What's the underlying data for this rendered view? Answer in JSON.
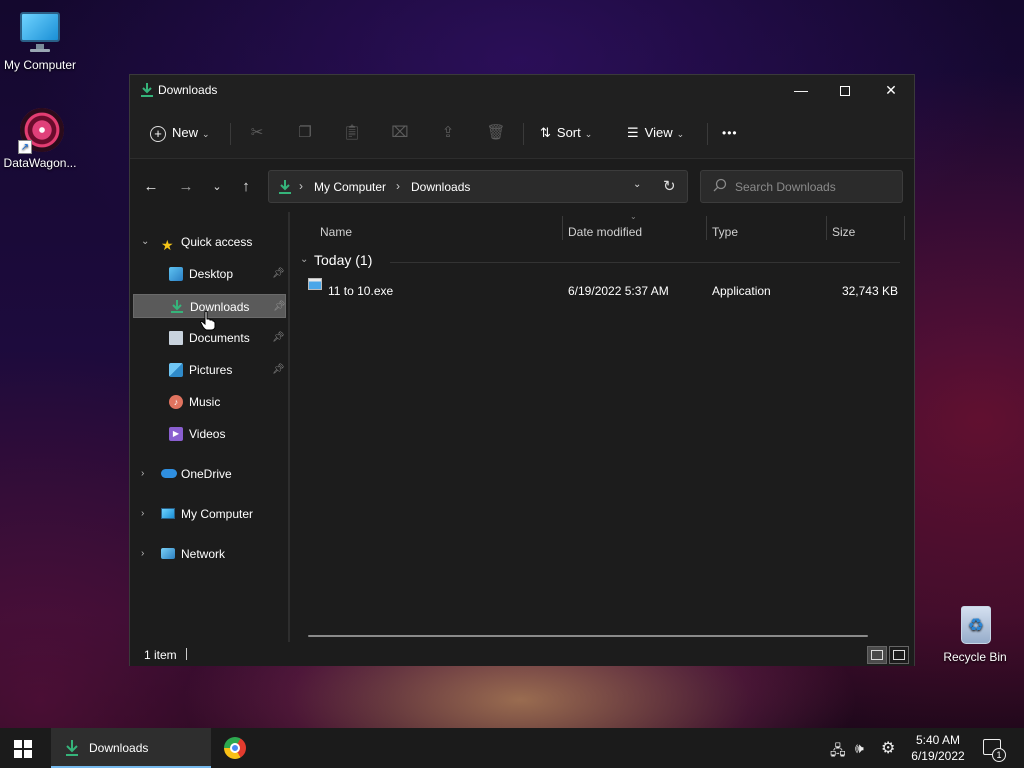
{
  "desktop": {
    "icons": [
      {
        "label": "My Computer"
      },
      {
        "label": "DataWagon..."
      },
      {
        "label": "Recycle Bin"
      }
    ]
  },
  "window": {
    "title": "Downloads",
    "toolbar": {
      "new_label": "New",
      "sort_label": "Sort",
      "view_label": "View",
      "more_label": "•••"
    },
    "address": {
      "crumbs": [
        "My Computer",
        "Downloads"
      ]
    },
    "search": {
      "placeholder": "Search Downloads"
    },
    "nav": {
      "quick_access": "Quick access",
      "items": [
        {
          "label": "Desktop",
          "pinned": true
        },
        {
          "label": "Downloads",
          "pinned": true,
          "selected": true
        },
        {
          "label": "Documents",
          "pinned": true
        },
        {
          "label": "Pictures",
          "pinned": true
        },
        {
          "label": "Music",
          "pinned": false
        },
        {
          "label": "Videos",
          "pinned": false
        }
      ],
      "onedrive": "OneDrive",
      "my_computer": "My Computer",
      "network": "Network"
    },
    "columns": {
      "name": "Name",
      "date": "Date modified",
      "type": "Type",
      "size": "Size"
    },
    "group": {
      "label": "Today (1)"
    },
    "files": [
      {
        "name": "11 to 10.exe",
        "date": "6/19/2022 5:37 AM",
        "type": "Application",
        "size": "32,743 KB"
      }
    ],
    "status": {
      "count": "1 item"
    }
  },
  "taskbar": {
    "active_task": "Downloads",
    "time": "5:40 AM",
    "date": "6/19/2022",
    "notification_count": "1"
  },
  "colors": {
    "accent": "#76b9ed",
    "download_green": "#35b47a",
    "window_bg": "#1c1c1c"
  }
}
